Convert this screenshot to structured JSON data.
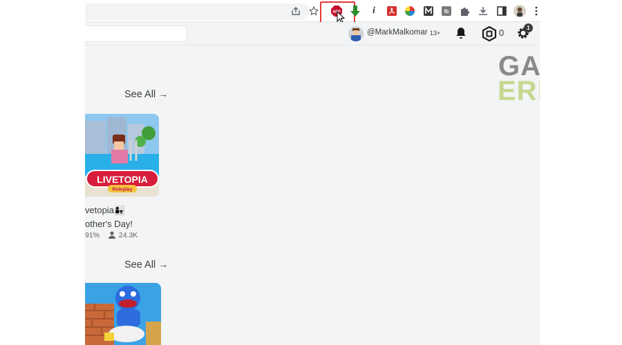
{
  "toolbar": {
    "icons": [
      "share-icon",
      "star-icon",
      "adblock-plus-icon",
      "download-arrow-icon",
      "info-icon",
      "pdf-icon",
      "color-wheel-icon",
      "m-extension-icon",
      "fb-extension-icon",
      "puzzle-icon",
      "download-icon",
      "sidepanel-icon",
      "profile-icon",
      "kebab-menu-icon"
    ],
    "abp_label": "ABP",
    "highlight_color": "#e53935"
  },
  "header": {
    "username": "@MarkMalkomar",
    "age_badge": "13+",
    "robux": "0",
    "notifications": "1"
  },
  "sections": [
    {
      "see_all": "See All",
      "arrow": "→"
    },
    {
      "see_all": "See All",
      "arrow": "→"
    }
  ],
  "game": {
    "logo": "LIVETOPIA",
    "sublogo": "Roleplay",
    "title_line1": "vetopia👩‍👧",
    "title_line2": "other's Day!",
    "rating": "91%",
    "players": "24.3K"
  },
  "watermark": {
    "line1": "GAMES",
    "line2": "ERRORS",
    "color1": "#8a8a8a",
    "color2": "#c5d88f"
  }
}
